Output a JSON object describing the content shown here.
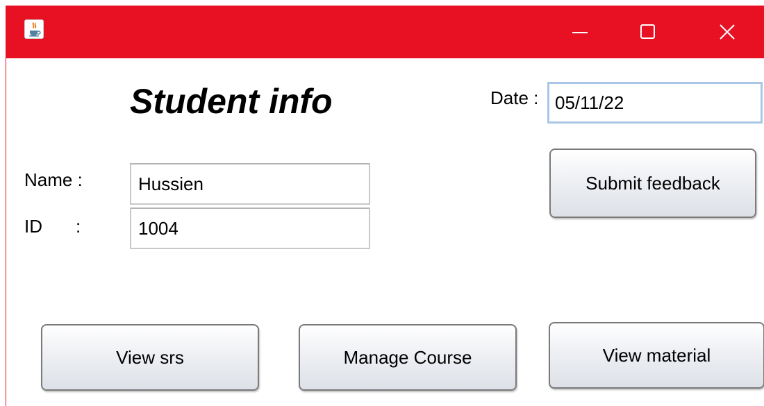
{
  "window": {
    "app_icon": "java-coffee-cup-icon",
    "controls": {
      "minimize_icon": "minimize-icon",
      "maximize_icon": "maximize-icon",
      "close_icon": "close-icon"
    },
    "title_bar_color": "#e81123"
  },
  "form": {
    "heading": "Student info",
    "date_label": "Date :",
    "date_value": "05/11/22",
    "name_label": "Name :",
    "name_value": "Hussien",
    "id_label": "ID",
    "id_colon": ":",
    "id_value": "1004"
  },
  "buttons": {
    "submit_feedback": "Submit feedback",
    "view_srs": "View srs",
    "manage_course": "Manage Course",
    "view_material": "View material"
  }
}
